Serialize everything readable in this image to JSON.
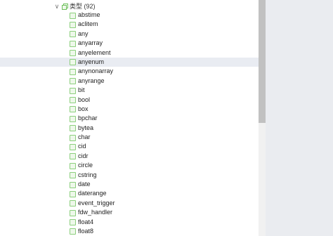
{
  "tree": {
    "group": {
      "expand_glyph": "∨",
      "label": "类型 (92)",
      "icon": "folder-copy-icon"
    },
    "items": [
      {
        "label": "abstime",
        "icon": "type-icon"
      },
      {
        "label": "aclitem",
        "icon": "type-icon"
      },
      {
        "label": "any",
        "icon": "type-icon"
      },
      {
        "label": "anyarray",
        "icon": "type-icon"
      },
      {
        "label": "anyelement",
        "icon": "type-icon"
      },
      {
        "label": "anyenum",
        "icon": "type-icon",
        "selected": true
      },
      {
        "label": "anynonarray",
        "icon": "type-icon"
      },
      {
        "label": "anyrange",
        "icon": "type-icon"
      },
      {
        "label": "bit",
        "icon": "type-icon"
      },
      {
        "label": "bool",
        "icon": "type-icon"
      },
      {
        "label": "box",
        "icon": "type-icon"
      },
      {
        "label": "bpchar",
        "icon": "type-icon"
      },
      {
        "label": "bytea",
        "icon": "type-icon"
      },
      {
        "label": "char",
        "icon": "type-icon"
      },
      {
        "label": "cid",
        "icon": "type-icon"
      },
      {
        "label": "cidr",
        "icon": "type-icon"
      },
      {
        "label": "circle",
        "icon": "type-icon"
      },
      {
        "label": "cstring",
        "icon": "type-icon"
      },
      {
        "label": "date",
        "icon": "type-icon"
      },
      {
        "label": "daterange",
        "icon": "type-icon"
      },
      {
        "label": "event_trigger",
        "icon": "type-icon"
      },
      {
        "label": "fdw_handler",
        "icon": "type-icon"
      },
      {
        "label": "float4",
        "icon": "type-icon"
      },
      {
        "label": "float8",
        "icon": "type-icon"
      }
    ]
  },
  "colors": {
    "selected_row": "#e9ecf2",
    "leaf_icon_border": "#8ccf7d",
    "group_icon": "#6cbf5a",
    "side_panel": "#eaecf0",
    "scroll_thumb": "#c1c1c1"
  }
}
